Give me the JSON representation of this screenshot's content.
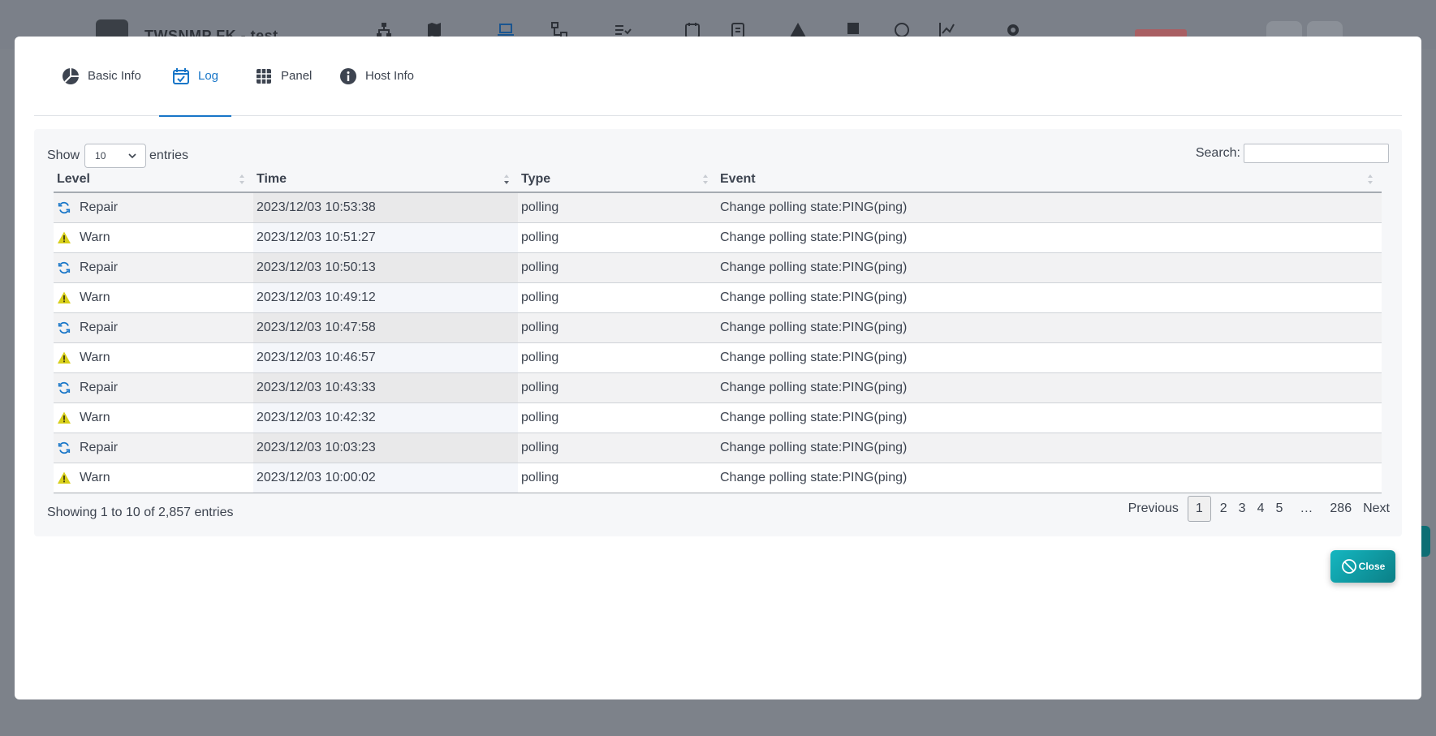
{
  "background": {
    "app_title": "TWSNMP FK - test"
  },
  "tabs": [
    {
      "label": "Basic Info",
      "icon": "pie-chart-icon",
      "active": false
    },
    {
      "label": "Log",
      "icon": "calendar-check-icon",
      "active": true
    },
    {
      "label": "Panel",
      "icon": "grid-icon",
      "active": false
    },
    {
      "label": "Host Info",
      "icon": "info-circle-icon",
      "active": false
    }
  ],
  "table_controls": {
    "show_label": "Show",
    "entries_label": "entries",
    "page_size": "10",
    "search_label": "Search:",
    "search_value": ""
  },
  "columns": [
    "Level",
    "Time",
    "Type",
    "Event"
  ],
  "rows": [
    {
      "level": "Repair",
      "time": "2023/12/03 10:53:38",
      "type": "polling",
      "event": "Change polling state:PING(ping)"
    },
    {
      "level": "Warn",
      "time": "2023/12/03 10:51:27",
      "type": "polling",
      "event": "Change polling state:PING(ping)"
    },
    {
      "level": "Repair",
      "time": "2023/12/03 10:50:13",
      "type": "polling",
      "event": "Change polling state:PING(ping)"
    },
    {
      "level": "Warn",
      "time": "2023/12/03 10:49:12",
      "type": "polling",
      "event": "Change polling state:PING(ping)"
    },
    {
      "level": "Repair",
      "time": "2023/12/03 10:47:58",
      "type": "polling",
      "event": "Change polling state:PING(ping)"
    },
    {
      "level": "Warn",
      "time": "2023/12/03 10:46:57",
      "type": "polling",
      "event": "Change polling state:PING(ping)"
    },
    {
      "level": "Repair",
      "time": "2023/12/03 10:43:33",
      "type": "polling",
      "event": "Change polling state:PING(ping)"
    },
    {
      "level": "Warn",
      "time": "2023/12/03 10:42:32",
      "type": "polling",
      "event": "Change polling state:PING(ping)"
    },
    {
      "level": "Repair",
      "time": "2023/12/03 10:03:23",
      "type": "polling",
      "event": "Change polling state:PING(ping)"
    },
    {
      "level": "Warn",
      "time": "2023/12/03 10:00:02",
      "type": "polling",
      "event": "Change polling state:PING(ping)"
    }
  ],
  "footer": {
    "info": "Showing 1 to 10 of 2,857 entries"
  },
  "pagination": {
    "previous": "Previous",
    "pages": [
      "1",
      "2",
      "3",
      "4",
      "5"
    ],
    "ellipsis": "…",
    "last": "286",
    "next": "Next"
  },
  "close_button": {
    "label": "Close",
    "icon": "ban-icon"
  },
  "colors": {
    "accent": "#1876c8",
    "repair": "#1876c8",
    "warn": "#d8cf1a",
    "close_start": "#15b7c1",
    "close_end": "#0b7f86"
  }
}
